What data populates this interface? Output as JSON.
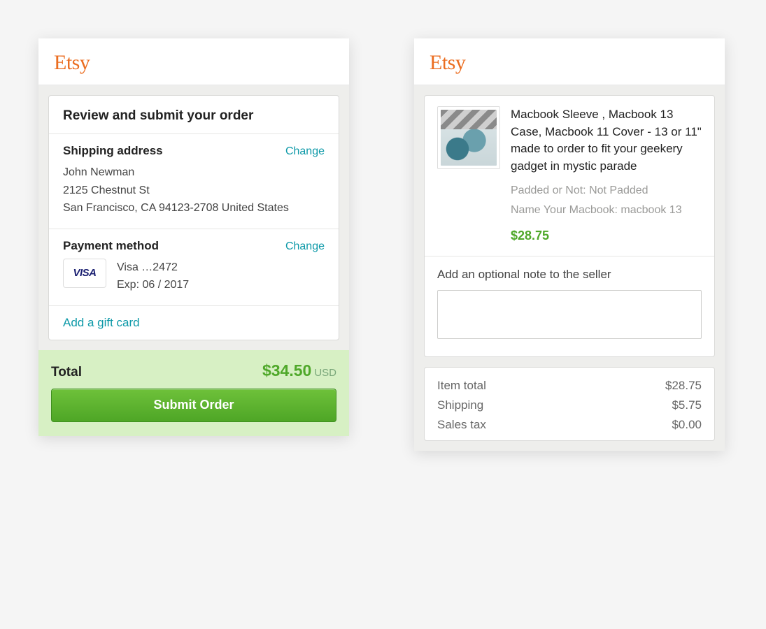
{
  "brand": "Etsy",
  "left": {
    "title": "Review and submit your order",
    "shipping": {
      "label": "Shipping address",
      "change": "Change",
      "name": "John Newman",
      "street": "2125 Chestnut St",
      "city_line": "San Francisco, CA 94123-2708 United States"
    },
    "payment": {
      "label": "Payment method",
      "change": "Change",
      "card_brand": "VISA",
      "card_line": "Visa …2472",
      "exp_line": "Exp: 06 / 2017"
    },
    "gift_link": "Add a gift card",
    "total": {
      "label": "Total",
      "amount": "$34.50",
      "currency": "USD",
      "submit": "Submit Order"
    }
  },
  "right": {
    "product": {
      "title": "Macbook Sleeve , Macbook 13 Case, Macbook 11 Cover - 13 or 11\" made to order to fit your geekery gadget in mystic parade",
      "option1": "Padded or Not: Not Padded",
      "option2": "Name Your Macbook: macbook 13",
      "price": "$28.75"
    },
    "note": {
      "label": "Add an optional note to the seller"
    },
    "summary": {
      "item_total_label": "Item total",
      "item_total_value": "$28.75",
      "shipping_label": "Shipping",
      "shipping_value": "$5.75",
      "tax_label": "Sales tax",
      "tax_value": "$0.00"
    }
  }
}
